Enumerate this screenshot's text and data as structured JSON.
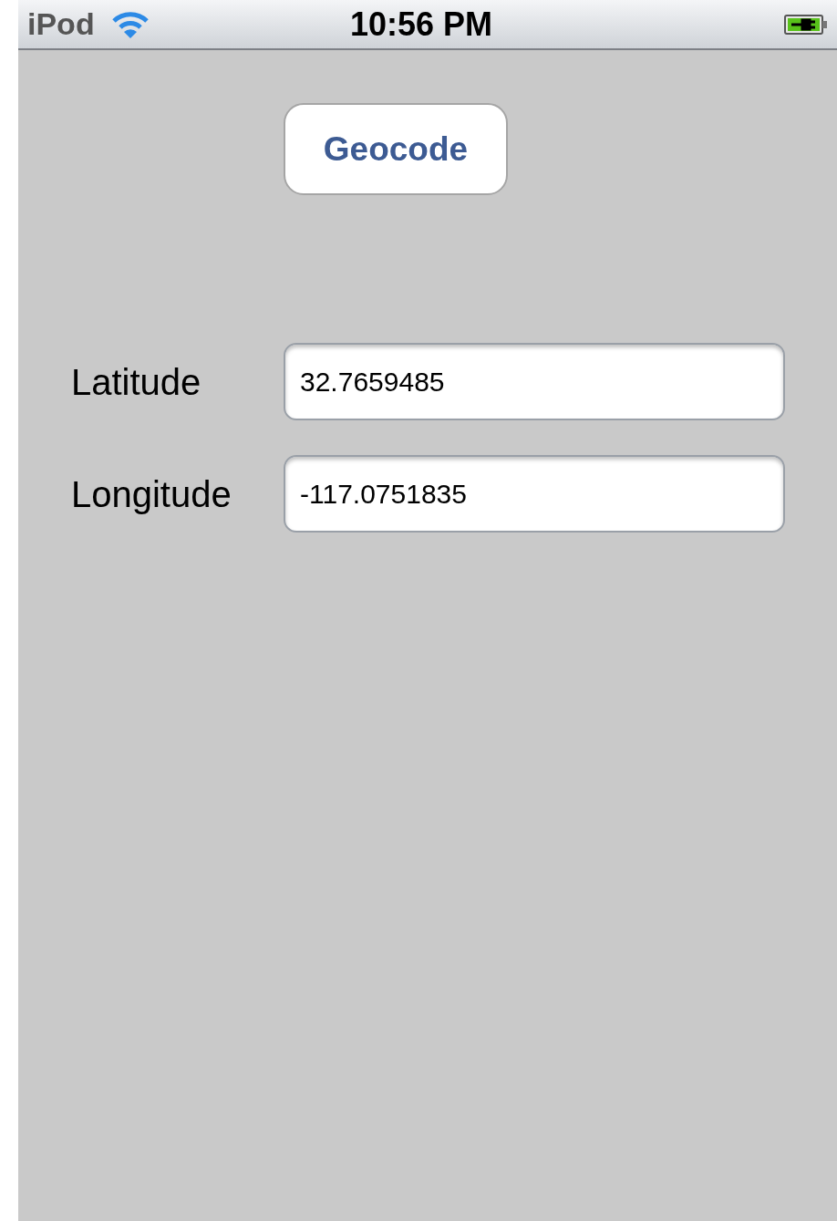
{
  "status_bar": {
    "carrier": "iPod",
    "time": "10:56 PM",
    "charging": true
  },
  "geocode_button": {
    "label": "Geocode"
  },
  "fields": [
    {
      "label": "Latitude",
      "value": "32.7659485"
    },
    {
      "label": "Longitude",
      "value": "-117.0751835"
    }
  ]
}
